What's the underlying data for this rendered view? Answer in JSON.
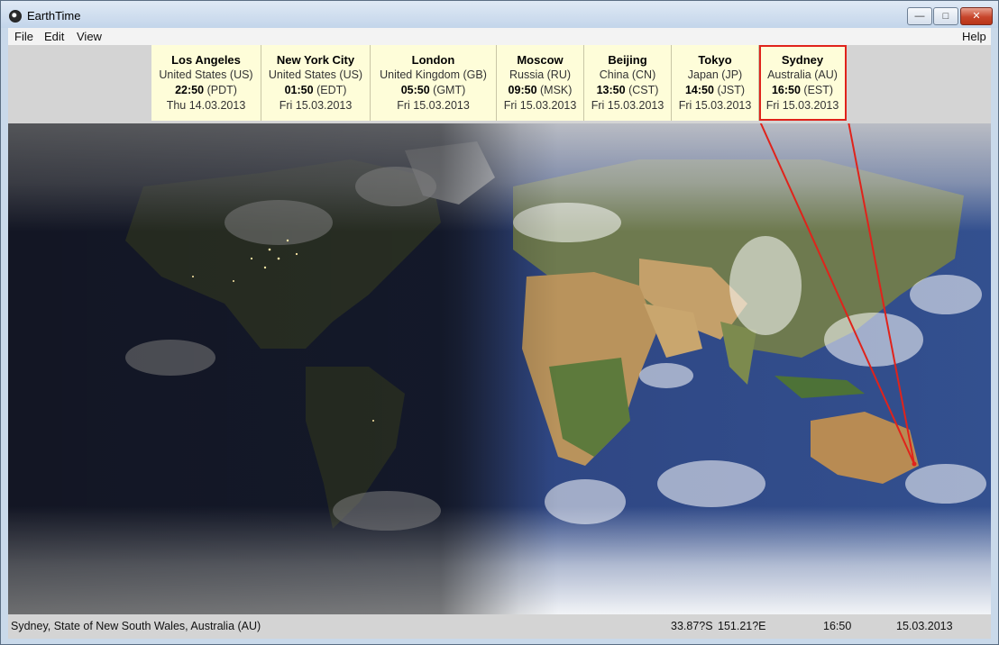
{
  "window": {
    "title": "EarthTime",
    "app_icon": "clock-icon",
    "controls": {
      "minimize": "—",
      "maximize": "□",
      "close": "✕"
    }
  },
  "menu": {
    "file": "File",
    "edit": "Edit",
    "view": "View",
    "help": "Help"
  },
  "cities": [
    {
      "name": "Los Angeles",
      "country": "United States (US)",
      "time": "22:50",
      "zone": "(PDT)",
      "date": "Thu 14.03.2013"
    },
    {
      "name": "New York City",
      "country": "United States (US)",
      "time": "01:50",
      "zone": "(EDT)",
      "date": "Fri 15.03.2013"
    },
    {
      "name": "London",
      "country": "United Kingdom (GB)",
      "time": "05:50",
      "zone": "(GMT)",
      "date": "Fri 15.03.2013"
    },
    {
      "name": "Moscow",
      "country": "Russia (RU)",
      "time": "09:50",
      "zone": "(MSK)",
      "date": "Fri 15.03.2013"
    },
    {
      "name": "Beijing",
      "country": "China (CN)",
      "time": "13:50",
      "zone": "(CST)",
      "date": "Fri 15.03.2013"
    },
    {
      "name": "Tokyo",
      "country": "Japan (JP)",
      "time": "14:50",
      "zone": "(JST)",
      "date": "Fri 15.03.2013"
    },
    {
      "name": "Sydney",
      "country": "Australia (AU)",
      "time": "16:50",
      "zone": "(EST)",
      "date": "Fri 15.03.2013"
    }
  ],
  "selected_city": "Sydney",
  "colors": {
    "selection": "#e0231b",
    "city_card": "#fefdd9"
  },
  "status": {
    "location": "Sydney, State of New South Wales, Australia (AU)",
    "latitude": "33.87?S",
    "longitude": "151.21?E",
    "time": "16:50",
    "date": "15.03.2013"
  }
}
